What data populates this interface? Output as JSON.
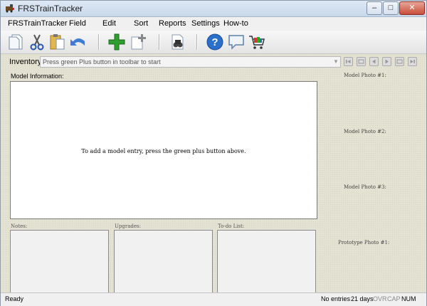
{
  "window": {
    "title": "FRSTrainTracker",
    "min": "–",
    "max": "□",
    "close": "✕"
  },
  "menu": [
    "FRSTrainTracker",
    "Field",
    "Edit",
    "Sort",
    "Reports",
    "Settings",
    "How-to"
  ],
  "toolbar": {
    "icons": [
      "new-document-icon",
      "cut-icon",
      "paste-icon",
      "undo-icon",
      "add-entry-icon",
      "duplicate-entry-icon",
      "search-binoculars-icon",
      "help-icon",
      "comment-icon",
      "shopping-cart-icon"
    ]
  },
  "inventory": {
    "label": "Inventory:",
    "select_text": "Press green Plus button in toolbar to start",
    "nav_icons": [
      "first-record-icon",
      "previous-page-icon",
      "previous-record-icon",
      "next-record-icon",
      "next-page-icon",
      "last-record-icon"
    ]
  },
  "model": {
    "label": "Model Information:",
    "hint": "To add a model entry, press the green plus button above."
  },
  "photos": [
    "Model Photo #1:",
    "Model Photo #2:",
    "Model Photo #3:",
    "Prototype Photo #1:"
  ],
  "panels": {
    "notes": "Notes:",
    "upgrades": "Upgrades:",
    "todo": "To-do List:"
  },
  "status": {
    "ready": "Ready",
    "entries": "No entries",
    "days": "21 days",
    "ovr": "OVR",
    "cap": "CAP",
    "num": "NUM"
  },
  "colors": {
    "add_green": "#2f9d2f",
    "help_blue": "#2a6fc9",
    "status_disabled": "#8a8a8a"
  }
}
